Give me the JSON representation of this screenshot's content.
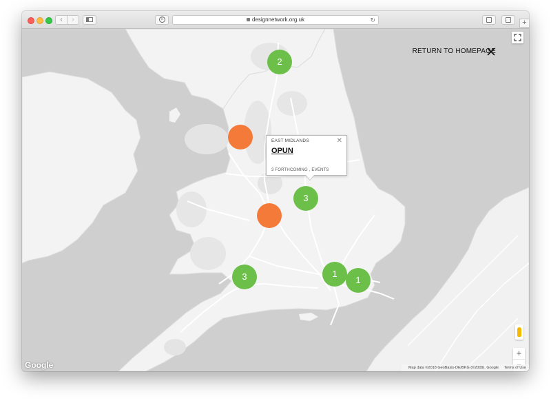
{
  "browser": {
    "url": "designnetwork.org.uk",
    "new_tab_label": "+"
  },
  "map": {
    "return_label": "RETURN TO HOMEPAGE",
    "clusters": [
      {
        "label": "2",
        "color": "#6cc04a"
      },
      {
        "label": "",
        "color": "#f47a3a"
      },
      {
        "label": "3",
        "color": "#6cc04a"
      },
      {
        "label": "",
        "color": "#f47a3a"
      },
      {
        "label": "3",
        "color": "#6cc04a"
      },
      {
        "label": "1",
        "color": "#6cc04a"
      },
      {
        "label": "1",
        "color": "#6cc04a"
      }
    ],
    "popup": {
      "region": "EAST MIDLANDS",
      "title": "OPUN",
      "events": "3 FORTHCOMING , EVENTS"
    },
    "zoom_in": "+",
    "zoom_out": "−",
    "google_logo": "Google",
    "attribution": {
      "map_data": "Map data ©2018 GeoBasis-DE/BKG (©2009), Google",
      "terms": "Terms of Use"
    }
  },
  "icons": {
    "close": "close-icon",
    "fullscreen": "fullscreen-icon",
    "pegman": "pegman-icon"
  }
}
